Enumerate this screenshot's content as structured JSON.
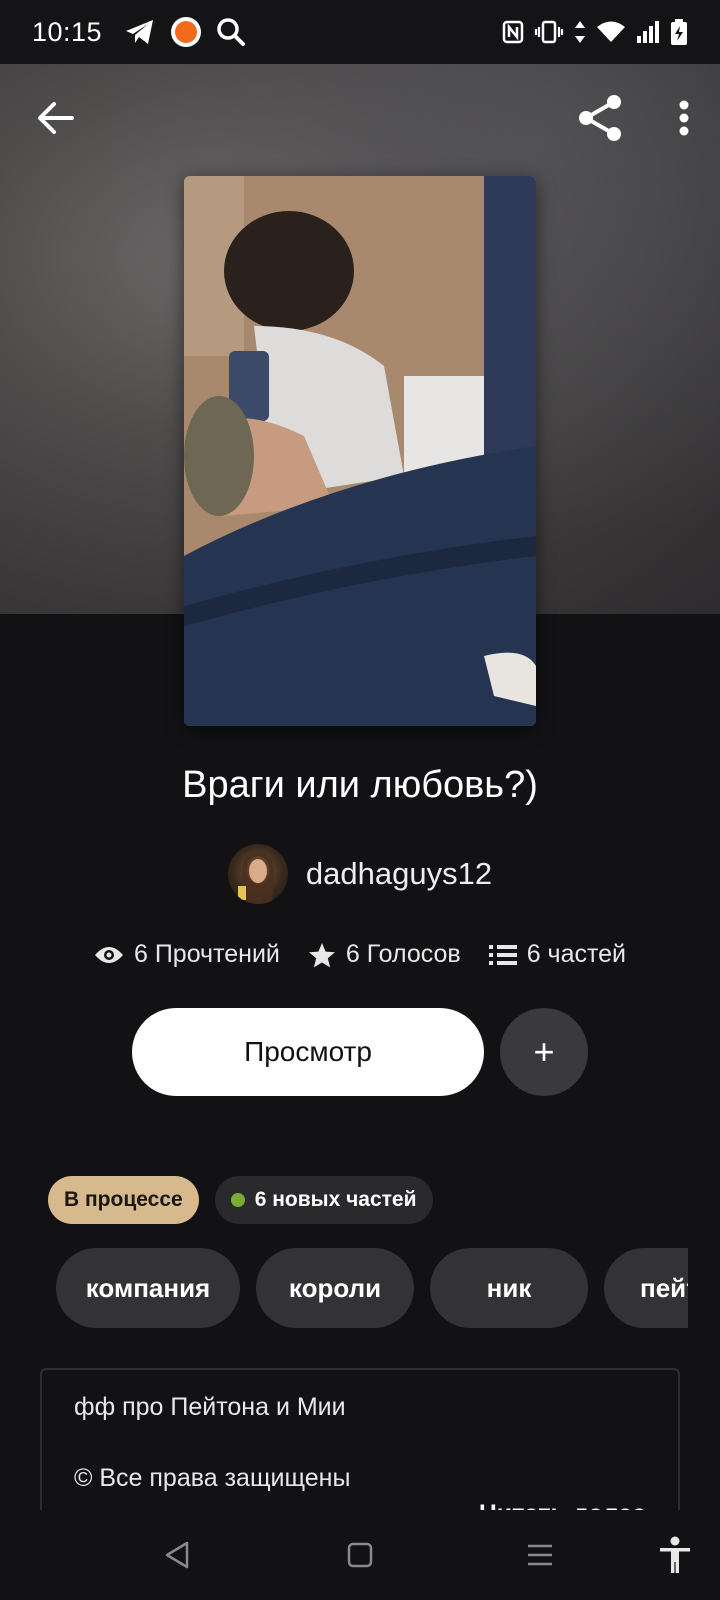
{
  "status_bar": {
    "time": "10:15",
    "left_icons": [
      "telegram-icon",
      "orange-app-icon",
      "search-icon"
    ],
    "right_icons": [
      "nfc-icon",
      "vibrate-icon",
      "data-arrows-icon",
      "wifi-icon",
      "signal-icon",
      "battery-charging-icon"
    ]
  },
  "top_bar": {
    "icons": [
      "back-arrow-icon",
      "share-icon",
      "more-vertical-icon"
    ]
  },
  "story": {
    "title": "Враги или любовь?)",
    "author": "dadhaguys12",
    "stats": {
      "reads": "6 Прочтений",
      "votes": "6 Голосов",
      "parts": "6 частей"
    },
    "read_button": "Просмотр",
    "add_button": "+",
    "status_badge": "В процессе",
    "new_parts_badge": "6 новых частей",
    "tags": [
      "компания",
      "короли",
      "ник",
      "пейтон"
    ],
    "description": {
      "line1": "фф про Пейтона и Мии",
      "line2": "© Все права защищены",
      "more": "Читать далее"
    }
  },
  "colors": {
    "background": "#121114",
    "status_badge": "#d6b98c",
    "new_dot": "#7aab37",
    "chip": "#333235"
  },
  "nav_bar": {
    "icons": [
      "nav-back-icon",
      "nav-home-icon",
      "nav-recents-icon",
      "accessibility-icon"
    ]
  }
}
